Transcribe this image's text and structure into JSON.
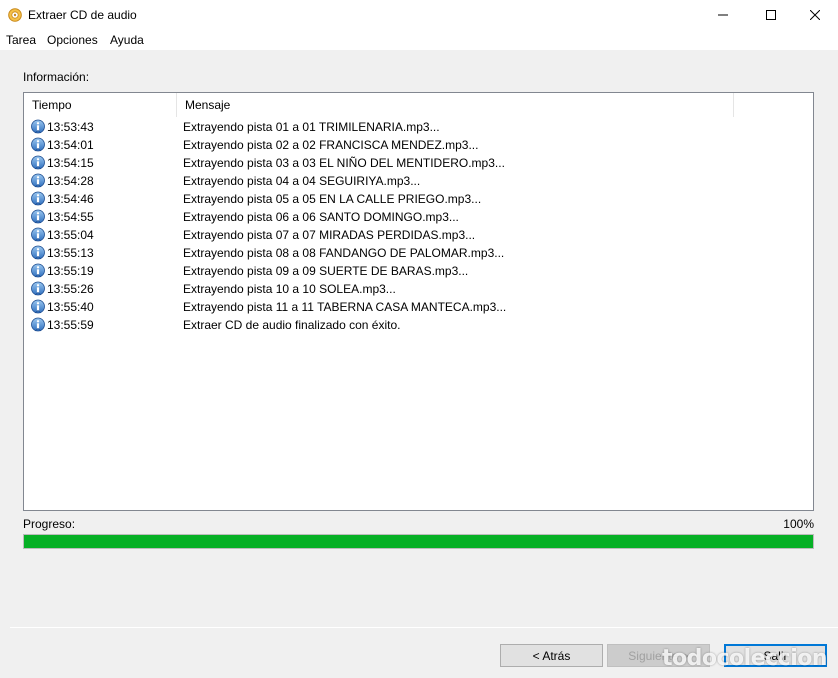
{
  "window": {
    "title": "Extraer CD de audio",
    "controls": [
      "minimize-icon",
      "maximize-icon",
      "close-icon"
    ]
  },
  "menu": {
    "items": [
      "Tarea",
      "Opciones",
      "Ayuda"
    ]
  },
  "info": {
    "label": "Información:"
  },
  "log": {
    "columns": [
      "Tiempo",
      "Mensaje"
    ],
    "row_icon": "info-icon",
    "rows": [
      {
        "time": "13:53:43",
        "message": "Extrayendo pista 01 a 01 TRIMILENARIA.mp3..."
      },
      {
        "time": "13:54:01",
        "message": "Extrayendo pista 02 a 02 FRANCISCA MENDEZ.mp3..."
      },
      {
        "time": "13:54:15",
        "message": "Extrayendo pista 03 a 03 EL NIÑO DEL MENTIDERO.mp3..."
      },
      {
        "time": "13:54:28",
        "message": "Extrayendo pista 04 a 04 SEGUIRIYA.mp3..."
      },
      {
        "time": "13:54:46",
        "message": "Extrayendo pista 05 a 05 EN LA CALLE PRIEGO.mp3..."
      },
      {
        "time": "13:54:55",
        "message": "Extrayendo pista 06 a 06 SANTO DOMINGO.mp3..."
      },
      {
        "time": "13:55:04",
        "message": "Extrayendo pista 07 a 07 MIRADAS PERDIDAS.mp3..."
      },
      {
        "time": "13:55:13",
        "message": "Extrayendo pista 08 a 08 FANDANGO DE PALOMAR.mp3..."
      },
      {
        "time": "13:55:19",
        "message": "Extrayendo pista 09 a 09 SUERTE DE BARAS.mp3..."
      },
      {
        "time": "13:55:26",
        "message": "Extrayendo pista 10 a 10 SOLEA.mp3..."
      },
      {
        "time": "13:55:40",
        "message": "Extrayendo pista 11 a 11 TABERNA CASA MANTECA.mp3..."
      },
      {
        "time": "13:55:59",
        "message": "Extraer CD de audio finalizado con éxito."
      }
    ]
  },
  "progress": {
    "label": "Progreso:",
    "percent_text": "100%",
    "value": 100,
    "color": "#06b025"
  },
  "buttons": {
    "back": "< Atrás",
    "next": "Siguiente >",
    "exit": "Salir"
  },
  "watermark": {
    "text": "todocoleccion"
  },
  "colors": {
    "accent": "#0078d7",
    "progress": "#06b025"
  }
}
